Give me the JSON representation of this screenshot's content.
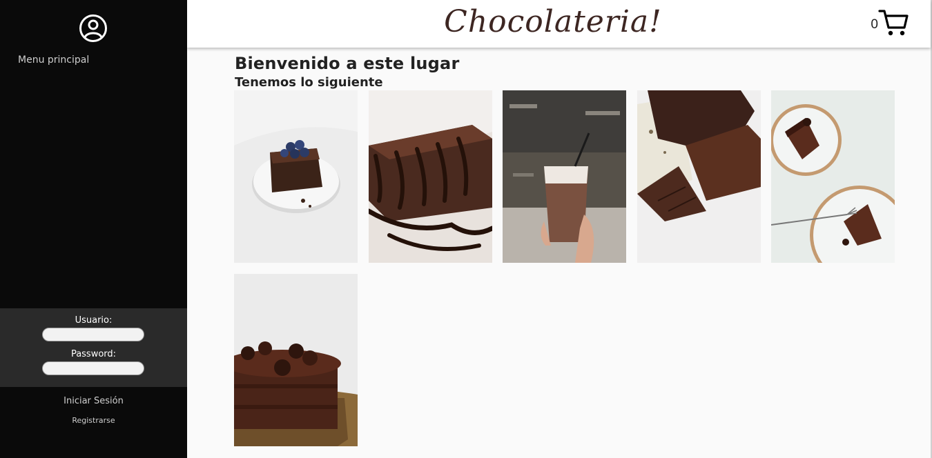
{
  "sidebar": {
    "menu_label": "Menu principal",
    "user_label": "Usuario:",
    "password_label": "Password:",
    "login_label": "Iniciar Sesión",
    "register_label": "Registrarse"
  },
  "header": {
    "brand": "Chocolateria!",
    "cart_count": "0"
  },
  "main": {
    "title": "Bienvenido a este lugar",
    "subtitle": "Tenemos lo siguiente"
  },
  "products": [
    {
      "icon": "brownie-blueberries-photo"
    },
    {
      "icon": "brownie-chocolate-drizzle-photo"
    },
    {
      "icon": "iced-chocolate-drink-photo"
    },
    {
      "icon": "chocolate-bars-photo"
    },
    {
      "icon": "chocolate-cake-slices-photo"
    },
    {
      "icon": "chocolate-truffle-cake-photo"
    }
  ],
  "colors": {
    "sidebar_bg": "#0a0a0a",
    "login_bg": "#2a2a2a",
    "brand": "#3d2622",
    "chocolate": "#3b1f16"
  }
}
